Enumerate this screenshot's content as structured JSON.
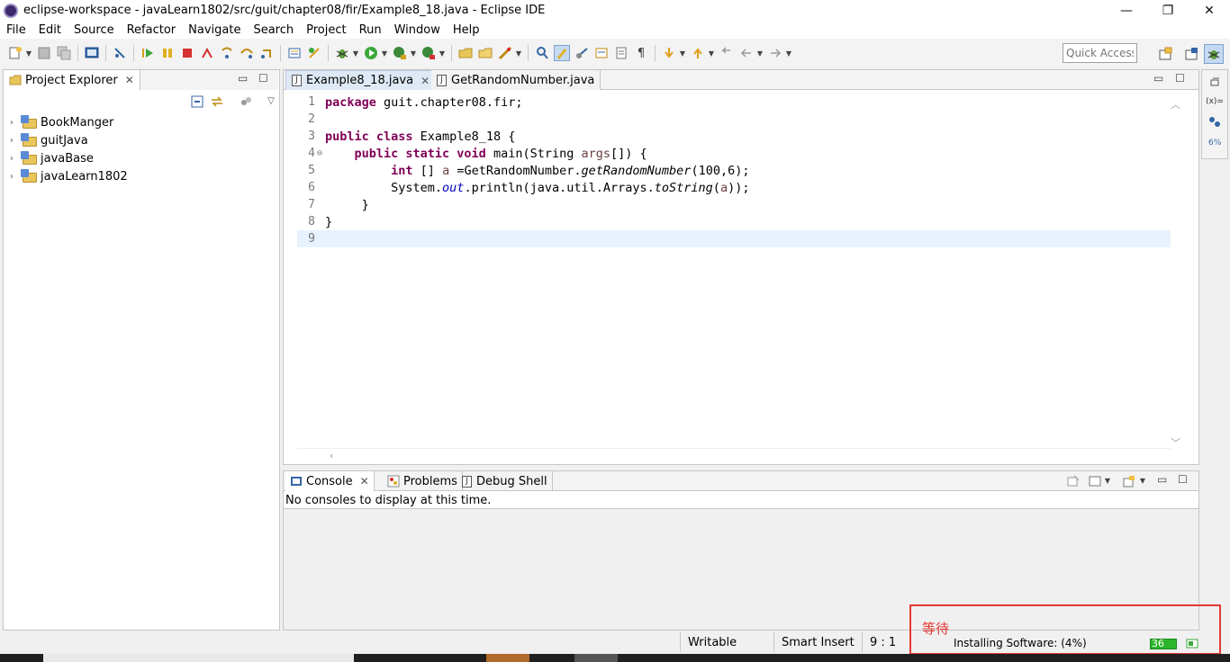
{
  "window": {
    "title": "eclipse-workspace - javaLearn1802/src/guit/chapter08/fir/Example8_18.java - Eclipse IDE",
    "minimize_glyph": "—",
    "restore_glyph": "❐",
    "close_glyph": "✕"
  },
  "menu": [
    "File",
    "Edit",
    "Source",
    "Refactor",
    "Navigate",
    "Search",
    "Project",
    "Run",
    "Window",
    "Help"
  ],
  "quick_access": {
    "placeholder": "Quick Access"
  },
  "explorer": {
    "title": "Project Explorer",
    "projects": [
      "BookManger",
      "guitJava",
      "javaBase",
      "javaLearn1802"
    ]
  },
  "editor": {
    "tabs": [
      {
        "label": "Example8_18.java",
        "active": true
      },
      {
        "label": "GetRandomNumber.java",
        "active": false
      }
    ],
    "lines": [
      {
        "num": "1",
        "fold": "",
        "html": "<span class=\"kw\">package</span> guit.chapter08.fir;"
      },
      {
        "num": "2",
        "fold": "",
        "html": ""
      },
      {
        "num": "3",
        "fold": "",
        "html": "<span class=\"kw\">public class</span> Example8_18 {"
      },
      {
        "num": "4",
        "fold": "⊖",
        "html": "    <span class=\"kw\">public static void</span> main(String <span class=\"var\">args</span>[]) {"
      },
      {
        "num": "5",
        "fold": "",
        "html": "         <span class=\"kw\">int</span> [] <span class=\"var\">a</span> =GetRandomNumber.<span class=\"ital\">getRandomNumber</span>(100,6);"
      },
      {
        "num": "6",
        "fold": "",
        "html": "         System.<span class=\"fld\">out</span>.println(java.util.Arrays.<span class=\"ital\">toString</span>(<span class=\"var\">a</span>));"
      },
      {
        "num": "7",
        "fold": "",
        "html": "     }"
      },
      {
        "num": "8",
        "fold": "",
        "html": "}"
      },
      {
        "num": "9",
        "fold": "",
        "html": ""
      }
    ],
    "current_line": 9
  },
  "console": {
    "tabs": [
      "Console",
      "Problems",
      "Debug Shell"
    ],
    "message": "No consoles to display at this time."
  },
  "status": {
    "writable": "Writable",
    "insert_mode": "Smart Insert",
    "position": "9 : 1",
    "progress_label": "Installing Software: (4%)",
    "progress_percent": 4,
    "badge": "36"
  },
  "annotation": {
    "text": "等待",
    "color": "#e53935"
  },
  "colors": {
    "keyword": "#7f0055",
    "field": "#0000c0",
    "local_var": "#6a3e3e",
    "current_line": "#e8f2fe",
    "progress": "#2bb52b"
  }
}
